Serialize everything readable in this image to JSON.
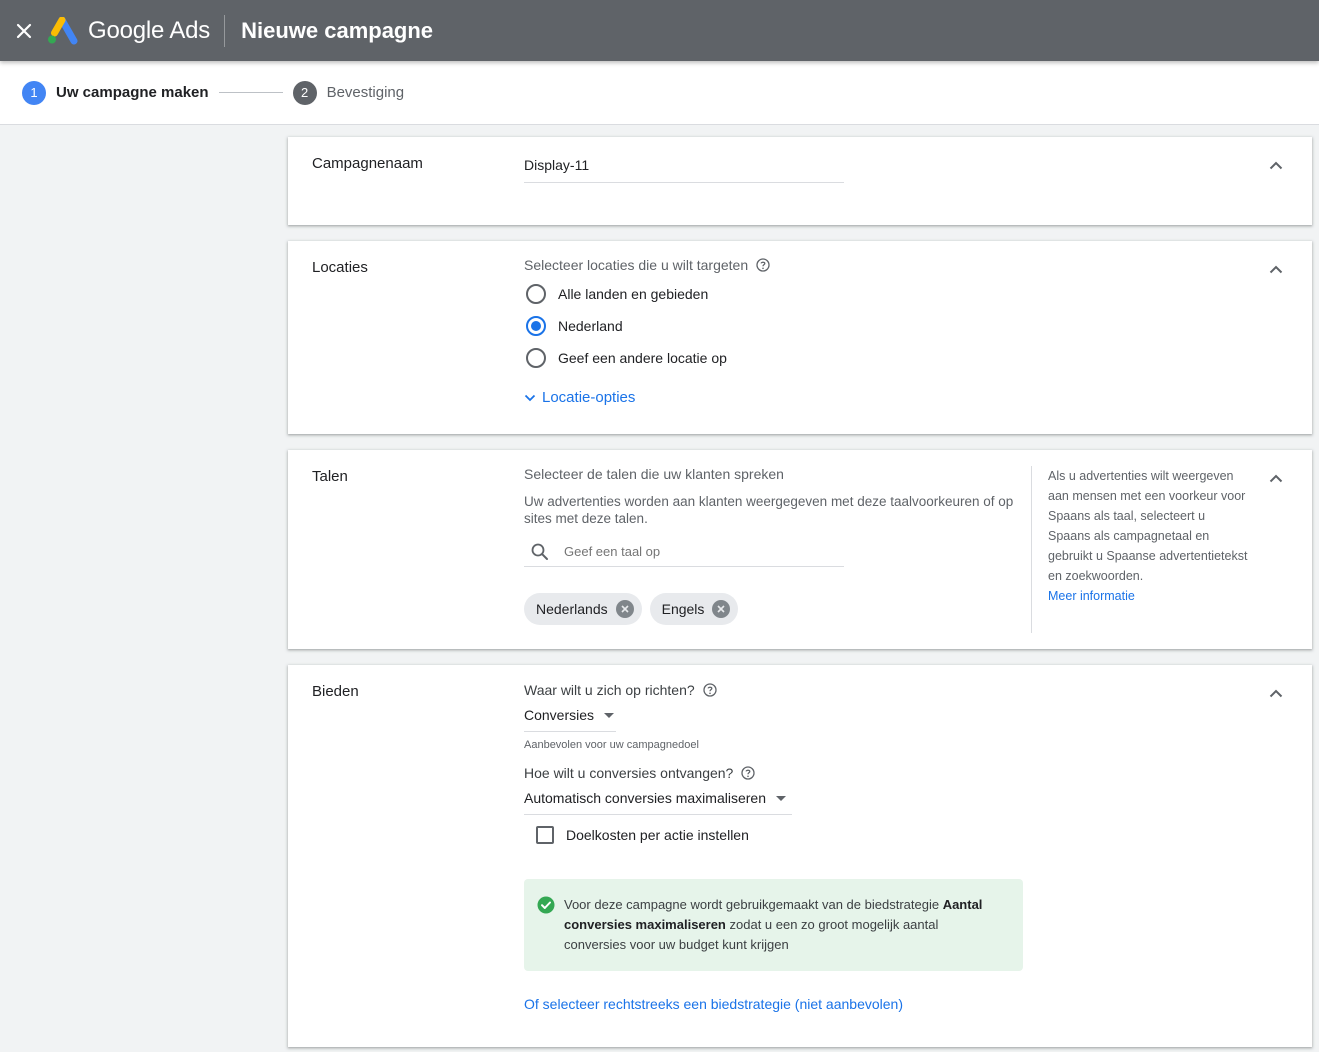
{
  "header": {
    "brand": "Google Ads",
    "title": "Nieuwe campagne"
  },
  "stepper": {
    "steps": [
      {
        "num": "1",
        "label": "Uw campagne maken"
      },
      {
        "num": "2",
        "label": "Bevestiging"
      }
    ]
  },
  "campaign_name": {
    "title": "Campagnenaam",
    "value": "Display-11"
  },
  "locations": {
    "title": "Locaties",
    "prompt": "Selecteer locaties die u wilt targeten",
    "options": [
      "Alle landen en gebieden",
      "Nederland",
      "Geef een andere locatie op"
    ],
    "selected": "Nederland",
    "options_link": "Locatie-opties"
  },
  "languages": {
    "title": "Talen",
    "prompt": "Selecteer de talen die uw klanten spreken",
    "description": "Uw advertenties worden aan klanten weergegeven met deze taalvoorkeuren of op sites met deze talen.",
    "search_placeholder": "Geef een taal op",
    "chips": [
      "Nederlands",
      "Engels"
    ],
    "side_note": "Als u advertenties wilt weergeven aan mensen met een voorkeur voor Spaans als taal, selecteert u Spaans als campagnetaal en gebruikt u Spaanse advertentietekst en zoekwoorden.",
    "side_link": "Meer informatie"
  },
  "bidding": {
    "title": "Bieden",
    "focus_label": "Waar wilt u zich op richten?",
    "focus_value": "Conversies",
    "focus_hint": "Aanbevolen voor uw campagnedoel",
    "receive_label": "Hoe wilt u conversies ontvangen?",
    "receive_value": "Automatisch conversies maximaliseren",
    "target_cpa_label": "Doelkosten per actie instellen",
    "notice_pre": "Voor deze campagne wordt gebruikgemaakt van de biedstrategie ",
    "notice_bold": "Aantal conversies maximaliseren",
    "notice_post": " zodat u een zo groot mogelijk aantal conversies voor uw budget kunt krijgen",
    "strategy_link": "Of selecteer rechtstreeks een biedstrategie (niet aanbevolen)"
  },
  "colors": {
    "topbar": "#5f6368",
    "accent": "#1a73e8",
    "success": "#34a853",
    "notice_bg": "#e6f4ea"
  }
}
